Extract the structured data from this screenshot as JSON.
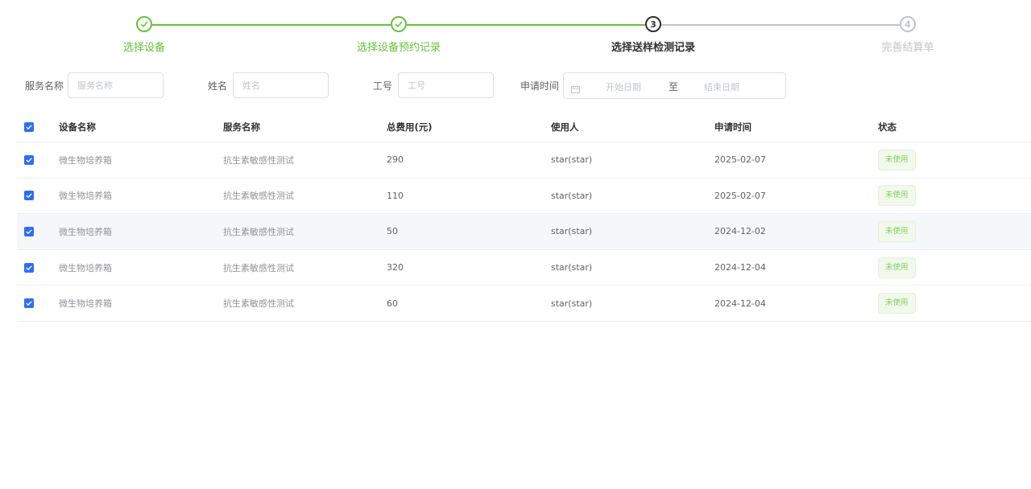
{
  "steps": [
    {
      "number": "1",
      "title": "选择设备",
      "state": "done"
    },
    {
      "number": "2",
      "title": "选择设备预约记录",
      "state": "done"
    },
    {
      "number": "3",
      "title": "选择送样检测记录",
      "state": "active"
    },
    {
      "number": "4",
      "title": "完善结算单",
      "state": "wait"
    }
  ],
  "filters": {
    "service_label": "服务名称",
    "service_placeholder": "服务名称",
    "name_label": "姓名",
    "name_placeholder": "姓名",
    "staff_label": "工号",
    "staff_placeholder": "工号",
    "time_label": "申请时间",
    "start_placeholder": "开始日期",
    "separator": "至",
    "end_placeholder": "结束日期"
  },
  "table": {
    "headers": {
      "device": "设备名称",
      "service": "服务名称",
      "fee": "总费用(元)",
      "user": "使用人",
      "time": "申请时间",
      "status": "状态"
    },
    "rows": [
      {
        "device": "微生物培养箱",
        "service": "抗生素敏感性测试",
        "fee": "290",
        "user": "star(star)",
        "time": "2025-02-07",
        "status": "未使用",
        "checked": true
      },
      {
        "device": "微生物培养箱",
        "service": "抗生素敏感性测试",
        "fee": "110",
        "user": "star(star)",
        "time": "2025-02-07",
        "status": "未使用",
        "checked": true
      },
      {
        "device": "微生物培养箱",
        "service": "抗生素敏感性测试",
        "fee": "50",
        "user": "star(star)",
        "time": "2024-12-02",
        "status": "未使用",
        "checked": true
      },
      {
        "device": "微生物培养箱",
        "service": "抗生素敏感性测试",
        "fee": "320",
        "user": "star(star)",
        "time": "2024-12-04",
        "status": "未使用",
        "checked": true
      },
      {
        "device": "微生物培养箱",
        "service": "抗生素敏感性测试",
        "fee": "60",
        "user": "star(star)",
        "time": "2024-12-04",
        "status": "未使用",
        "checked": true
      }
    ]
  },
  "colors": {
    "success": "#67c23a",
    "active": "#303133",
    "wait": "#c0c4cc",
    "checkbox": "#2f6fed",
    "tag_bg": "#f0f9eb"
  }
}
